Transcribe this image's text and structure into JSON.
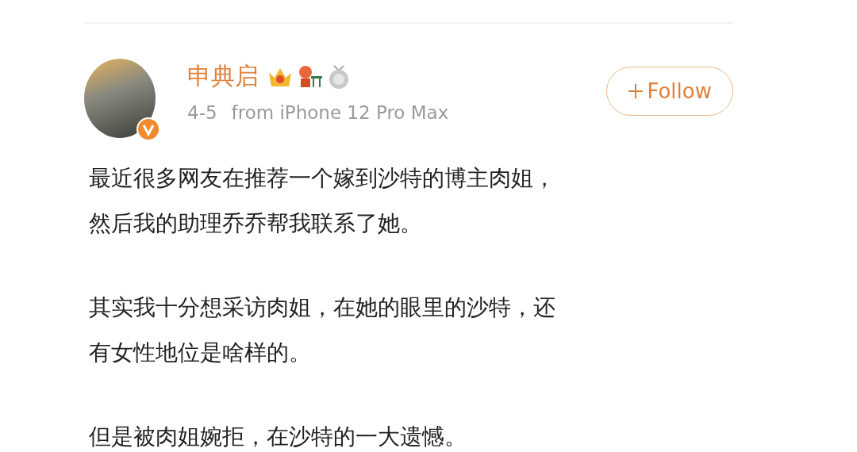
{
  "post": {
    "author": "申典启",
    "date": "4-5",
    "source": "from iPhone 12 Pro Max",
    "follow_button": "Follow",
    "paragraphs": [
      [
        "最近很多网友在推荐一个嫁到沙特的博主肉姐，",
        "然后我的助理乔乔帮我联系了她。"
      ],
      [
        "其实我十分想采访肉姐，在她的眼里的沙特，还",
        "有女性地位是啥样的。"
      ],
      [
        "但是被肉姐婉拒，在沙特的一大遗憾。"
      ]
    ]
  }
}
